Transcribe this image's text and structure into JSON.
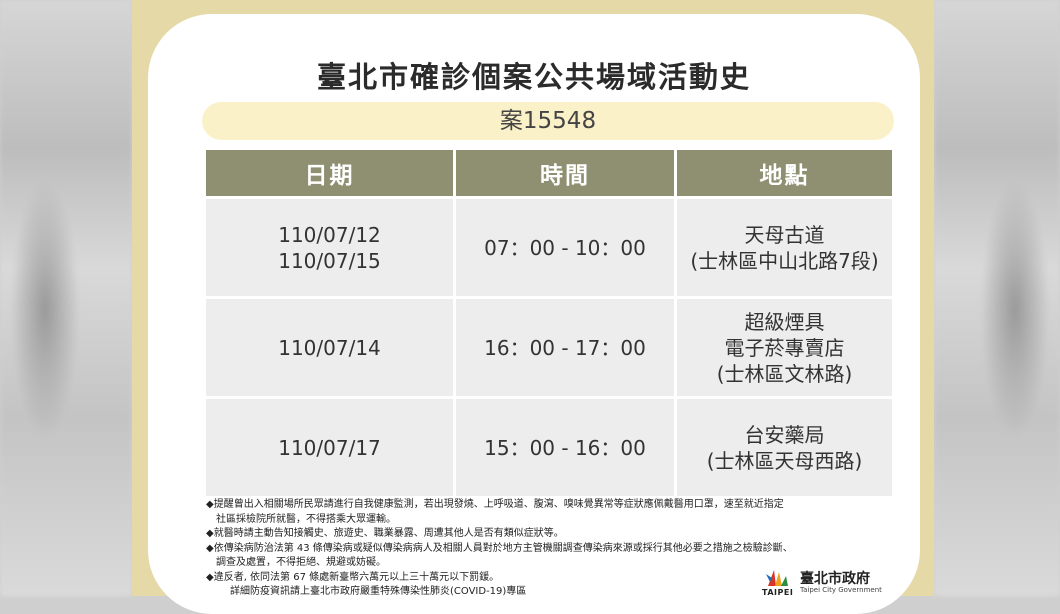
{
  "title": "臺北市確診個案公共場域活動史",
  "case_label": "案15548",
  "table": {
    "headers": [
      "日期",
      "時間",
      "地點"
    ],
    "rows": [
      {
        "date": [
          "110/07/12",
          "110/07/15"
        ],
        "time": "07：00 - 10：00",
        "place": [
          "天母古道",
          "(士林區中山北路7段)"
        ]
      },
      {
        "date": [
          "110/07/14"
        ],
        "time": "16：00 - 17：00",
        "place": [
          "超級煙具",
          "電子菸專賣店",
          "(士林區文林路)"
        ]
      },
      {
        "date": [
          "110/07/17"
        ],
        "time": "15：00 - 16：00",
        "place": [
          "台安藥局",
          "(士林區天母西路)"
        ]
      }
    ]
  },
  "notes": [
    {
      "text": "◆提醒曾出入相關場所民眾請進行自我健康監測，若出現發燒、上呼吸道、腹瀉、嗅味覺異常等症狀應佩戴醫用口罩，速至就近指定",
      "indent": 0
    },
    {
      "text": "社區採檢院所就醫，不得搭乘大眾運輸。",
      "indent": 1
    },
    {
      "text": "◆就醫時請主動告知接觸史、旅遊史、職業暴露、周遭其他人是否有類似症狀等。",
      "indent": 0
    },
    {
      "text": "◆依傳染病防治法第 43 條傳染病或疑似傳染病病人及相關人員對於地方主管機關調查傳染病來源或採行其他必要之措施之檢驗診斷、",
      "indent": 0
    },
    {
      "text": "調查及處置，不得拒絕、規避或妨礙。",
      "indent": 1
    },
    {
      "text": "◆違反者, 依同法第 67 條處新臺幣六萬元以上三十萬元以下罰鍰。",
      "indent": 0
    },
    {
      "text": "詳細防疫資訊請上臺北市政府嚴重特殊傳染性肺炎(COVID-19)專區",
      "indent": 2
    }
  ],
  "logo": {
    "name": "臺北市政府",
    "en": "TAIPEI",
    "sub": "Taipei City Government"
  },
  "colors": {
    "panel": "#e6d9a8",
    "pill": "#fbf1c9",
    "header": "#8f8f72",
    "cell": "#ededed"
  }
}
